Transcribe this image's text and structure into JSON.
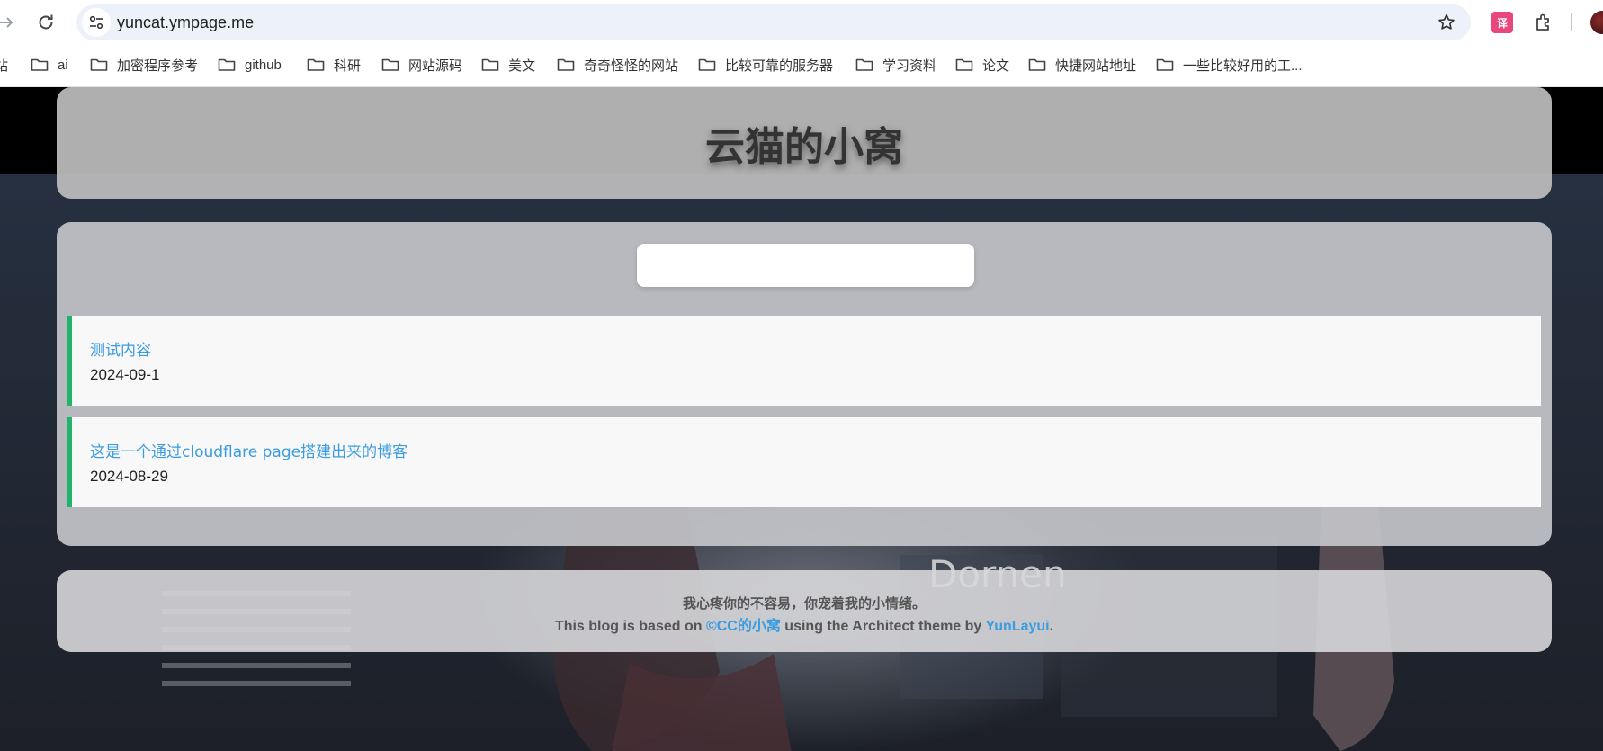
{
  "browser": {
    "url": "yuncat.ympage.me",
    "bookmarks": [
      "站",
      "ai",
      "加密程序参考",
      "github",
      "科研",
      "网站源码",
      "美文",
      "奇奇怪怪的网站",
      "比较可靠的服务器",
      "学习资料",
      "论文",
      "快捷网站地址",
      "一些比较好用的工..."
    ]
  },
  "header": {
    "title": "云猫的小窝"
  },
  "search": {
    "value": ""
  },
  "posts": [
    {
      "title": "测试内容",
      "date": "2024-09-1"
    },
    {
      "title": "这是一个通过cloudflare page搭建出来的博客",
      "date": "2024-08-29"
    }
  ],
  "footer": {
    "motto": "我心疼你的不容易，你宠着我的小情绪。",
    "based_prefix": "This blog is based on ",
    "based_link": "©CC的小窝",
    "theme_mid": " using the Architect theme by ",
    "theme_link": "YunLayui",
    "suffix": "."
  },
  "colors": {
    "accent_link": "#3b9ce0",
    "post_border": "#1fb46a"
  }
}
